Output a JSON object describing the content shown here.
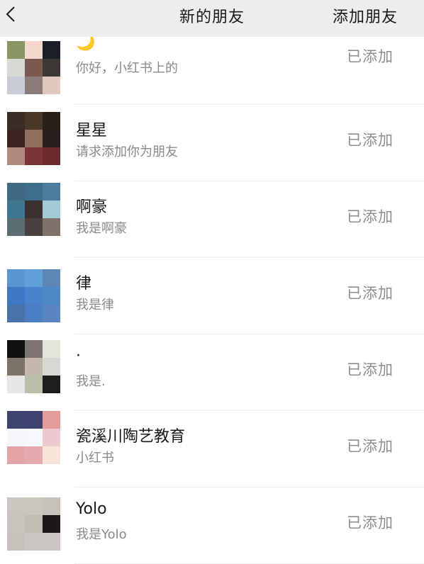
{
  "header": {
    "back_icon": "chevron-left-icon",
    "title": "新的朋友",
    "action": "添加朋友"
  },
  "requests": [
    {
      "name": "🌙",
      "message": "你好，小红书上的",
      "status": "已添加",
      "avatar_colors": [
        "#899463",
        "#f3d8cb",
        "#1a1e29",
        "#d7d9d3",
        "#7a594e",
        "#3b3835",
        "#c8ccd6",
        "#8b7b79",
        "#e0c8bf"
      ]
    },
    {
      "name": "星星",
      "message": "请求添加你为朋友",
      "status": "已添加",
      "avatar_colors": [
        "#3a2c26",
        "#4a3829",
        "#2a2019",
        "#3c2320",
        "#8f6e5b",
        "#2b1f1d",
        "#b08a7e",
        "#7a3537",
        "#6b2a2d"
      ]
    },
    {
      "name": "啊豪",
      "message": "我是啊豪",
      "status": "已添加",
      "avatar_colors": [
        "#3f6a82",
        "#3c6f8c",
        "#4a7c9c",
        "#3e7890",
        "#3a302e",
        "#a4cad7",
        "#5b6d73",
        "#4a4040",
        "#7e726a"
      ]
    },
    {
      "name": "律",
      "message": "我是律",
      "status": "已添加",
      "avatar_colors": [
        "#5b94d2",
        "#5fa0d6",
        "#5e86b5",
        "#3f77c2",
        "#4a82cb",
        "#4d87c5",
        "#4873a8",
        "#4a7fc5",
        "#5984c0"
      ]
    },
    {
      "name": "·",
      "message": "我是.",
      "status": "已添加",
      "avatar_colors": [
        "#111111",
        "#7e7471",
        "#e4e4dc",
        "#7e7369",
        "#c4b7ac",
        "#d6d8d2",
        "#e7e5e5",
        "#b8c1a8",
        "#1e1f1c"
      ]
    },
    {
      "name": "瓷溪川陶艺教育",
      "message": "小红书",
      "status": "已添加",
      "avatar_colors": [
        "#3e4470",
        "#3e4270",
        "#e39c9a",
        "#f5f7fb",
        "#f6f8fc",
        "#ecc8d0",
        "#e4a3a7",
        "#e5aaad",
        "#f8e3d8"
      ]
    },
    {
      "name": "Yolo",
      "message": "我是Yolo",
      "status": "已添加",
      "avatar_colors": [
        "#c9c6c0",
        "#cbc7bf",
        "#c6c2bb",
        "#c7c4bd",
        "#c2beb7",
        "#1c1716",
        "#c5c2bc",
        "#cac7c2",
        "#c9c6c1"
      ]
    }
  ]
}
